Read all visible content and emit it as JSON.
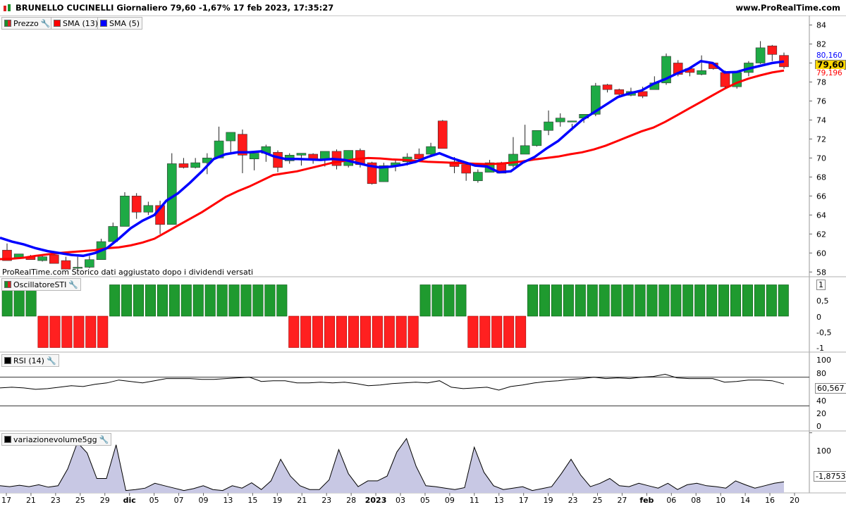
{
  "header": {
    "title": "BRUNELLO CUCINELLI Giornaliero 79,60 -1,67% 17 feb 2023, 17:35:27",
    "site": "www.ProRealTime.com"
  },
  "legend": [
    {
      "label": "Prezzo",
      "color": "#1a8f2a"
    },
    {
      "label": "SMA (13)",
      "color": "#ff0000"
    },
    {
      "label": "SMA (5)",
      "color": "#0000ff"
    }
  ],
  "note": "ProRealTime.com  Storico dati aggiustato dopo i dividendi versati",
  "price_axis": {
    "ticks": [
      "84",
      "82",
      "80",
      "78",
      "76",
      "74",
      "72",
      "70",
      "68",
      "66",
      "64",
      "62",
      "60",
      "58"
    ],
    "badge_sma5": "80,160",
    "badge_price": "79,60",
    "badge_sma13": "79,196"
  },
  "osc_panel": {
    "label": "OscillatoreSTI",
    "ticks": [
      "1",
      "0,5",
      "0",
      "-0,5",
      "-1"
    ]
  },
  "rsi_panel": {
    "label": "RSI (14)",
    "ticks": [
      "100",
      "80",
      "60",
      "40",
      "20",
      "0"
    ],
    "badge": "60,567"
  },
  "vol_panel": {
    "label": "variazionevolume5gg",
    "ticks": [
      "100"
    ],
    "badge": "-1,8753"
  },
  "x_axis": {
    "labels": [
      "17",
      "21",
      "23",
      "25",
      "29",
      "dic",
      "05",
      "07",
      "09",
      "13",
      "15",
      "19",
      "21",
      "23",
      "28",
      "2023",
      "03",
      "05",
      "09",
      "11",
      "13",
      "17",
      "19",
      "23",
      "25",
      "27",
      "feb",
      "06",
      "08",
      "10",
      "14",
      "16",
      "20"
    ]
  },
  "colors": {
    "up": "#1eaa45",
    "down": "#ff1a1a",
    "sma13": "#ff0000",
    "sma5": "#0000ff",
    "osc_up": "#1f9a2f",
    "osc_down": "#ff2020",
    "volume_fill": "#c8c8e4"
  },
  "chart_data": [
    {
      "type": "candlestick",
      "title": "BRUNELLO CUCINELLI Giornaliero",
      "ylim": [
        57.5,
        85
      ],
      "ohlc": [
        [
          60.3,
          61.0,
          59.9,
          59.2
        ],
        [
          59.5,
          59.9,
          59.5,
          59.9
        ],
        [
          59.6,
          59.8,
          59.4,
          59.3
        ],
        [
          59.2,
          59.7,
          59.1,
          59.6
        ],
        [
          59.8,
          60.1,
          59.1,
          58.9
        ],
        [
          59.2,
          59.6,
          58.5,
          58.3
        ],
        [
          58.5,
          59.6,
          58.1,
          58.5
        ],
        [
          58.5,
          59.7,
          58.4,
          59.3
        ],
        [
          59.3,
          61.5,
          59.3,
          61.2
        ],
        [
          61.2,
          63.2,
          61.0,
          62.8
        ],
        [
          62.8,
          66.4,
          62.8,
          66.0
        ],
        [
          66.0,
          66.3,
          63.6,
          64.3
        ],
        [
          64.3,
          65.4,
          64.0,
          65.0
        ],
        [
          65.0,
          65.5,
          62.0,
          63.0
        ],
        [
          63.0,
          70.5,
          63.0,
          69.4
        ],
        [
          69.4,
          70.0,
          68.9,
          69.0
        ],
        [
          69.0,
          70.0,
          68.9,
          69.5
        ],
        [
          69.5,
          70.5,
          68.3,
          70.0
        ],
        [
          70.0,
          73.3,
          70.0,
          71.8
        ],
        [
          71.8,
          72.6,
          70.4,
          72.7
        ],
        [
          72.5,
          73.0,
          68.4,
          70.3
        ],
        [
          69.9,
          70.1,
          68.7,
          70.5
        ],
        [
          70.5,
          71.4,
          69.6,
          71.2
        ],
        [
          70.6,
          70.8,
          68.5,
          69.0
        ],
        [
          69.7,
          70.5,
          69.4,
          70.3
        ],
        [
          70.3,
          70.4,
          69.2,
          70.5
        ],
        [
          70.4,
          70.5,
          69.4,
          69.9
        ],
        [
          69.9,
          70.6,
          69.1,
          70.7
        ],
        [
          70.7,
          70.9,
          68.8,
          69.2
        ],
        [
          69.2,
          70.8,
          69.0,
          70.8
        ],
        [
          70.8,
          71.0,
          69.0,
          69.3
        ],
        [
          69.5,
          69.6,
          67.2,
          67.3
        ],
        [
          67.5,
          69.5,
          67.5,
          69.2
        ],
        [
          69.2,
          69.9,
          68.6,
          69.5
        ],
        [
          69.6,
          70.5,
          69.2,
          70.1
        ],
        [
          70.4,
          71.0,
          69.6,
          69.9
        ],
        [
          70.4,
          71.6,
          70.1,
          71.2
        ],
        [
          73.9,
          74.0,
          71.5,
          71.0
        ],
        [
          69.6,
          70.1,
          68.4,
          69.1
        ],
        [
          69.3,
          69.5,
          67.6,
          68.4
        ],
        [
          67.6,
          68.8,
          67.4,
          68.5
        ],
        [
          68.5,
          69.8,
          68.7,
          69.5
        ],
        [
          69.5,
          69.6,
          68.7,
          68.4
        ],
        [
          69.2,
          72.2,
          69.0,
          70.4
        ],
        [
          70.4,
          73.5,
          70.6,
          71.3
        ],
        [
          71.3,
          72.8,
          71.2,
          72.9
        ],
        [
          72.9,
          75.0,
          72.4,
          73.8
        ],
        [
          73.8,
          74.7,
          73.3,
          74.2
        ],
        [
          73.9,
          73.6,
          72.9,
          73.9
        ],
        [
          74.2,
          74.5,
          73.7,
          74.6
        ],
        [
          74.6,
          77.9,
          74.4,
          77.6
        ],
        [
          77.7,
          77.8,
          76.9,
          77.2
        ],
        [
          77.2,
          77.3,
          76.4,
          76.7
        ],
        [
          76.6,
          77.4,
          76.5,
          77.0
        ],
        [
          77.0,
          77.5,
          76.3,
          76.5
        ],
        [
          77.2,
          78.6,
          77.2,
          77.9
        ],
        [
          77.9,
          81.0,
          77.7,
          80.7
        ],
        [
          80.0,
          80.3,
          78.6,
          78.8
        ],
        [
          79.4,
          79.1,
          78.6,
          79.0
        ],
        [
          78.8,
          80.8,
          78.7,
          79.2
        ],
        [
          80.0,
          80.1,
          79.3,
          79.4
        ],
        [
          79.0,
          79.2,
          77.3,
          77.5
        ],
        [
          77.5,
          79.1,
          77.3,
          79.0
        ],
        [
          79.0,
          80.2,
          78.6,
          80.0
        ],
        [
          80.0,
          82.3,
          79.9,
          81.6
        ],
        [
          81.8,
          81.9,
          80.2,
          80.9
        ],
        [
          80.8,
          81.1,
          79.4,
          79.6
        ]
      ],
      "series": [
        {
          "name": "SMA (13)",
          "values": [
            59.35,
            59.4,
            59.5,
            59.7,
            59.85,
            60.0,
            60.1,
            60.2,
            60.3,
            60.5,
            60.6,
            60.8,
            61.1,
            61.5,
            62.2,
            62.9,
            63.6,
            64.3,
            65.1,
            65.9,
            66.5,
            67.0,
            67.6,
            68.2,
            68.4,
            68.6,
            68.9,
            69.2,
            69.5,
            69.7,
            69.9,
            70.0,
            69.95,
            69.85,
            69.8,
            69.7,
            69.6,
            69.55,
            69.5,
            69.45,
            69.4,
            69.35,
            69.4,
            69.5,
            69.65,
            69.85,
            70.0,
            70.15,
            70.4,
            70.6,
            70.9,
            71.3,
            71.8,
            72.3,
            72.8,
            73.2,
            73.8,
            74.5,
            75.2,
            75.9,
            76.6,
            77.3,
            77.9,
            78.35,
            78.7,
            79.0,
            79.2
          ]
        },
        {
          "name": "SMA (5)",
          "values": [
            61.6,
            61.2,
            60.9,
            60.5,
            60.2,
            60.0,
            59.8,
            59.7,
            60.0,
            60.5,
            61.5,
            62.6,
            63.4,
            64.0,
            65.5,
            66.3,
            67.4,
            68.6,
            69.9,
            70.4,
            70.6,
            70.6,
            70.7,
            70.2,
            69.9,
            69.9,
            69.85,
            69.8,
            69.9,
            69.8,
            69.5,
            69.2,
            69.0,
            69.1,
            69.3,
            69.6,
            70.1,
            70.5,
            70.0,
            69.6,
            69.2,
            69.1,
            68.5,
            68.6,
            69.5,
            70.1,
            71.0,
            71.8,
            72.9,
            74.0,
            74.8,
            75.6,
            76.4,
            76.8,
            77.1,
            77.8,
            78.3,
            78.9,
            79.4,
            80.2,
            80.0,
            79.0,
            79.05,
            79.4,
            79.7,
            80.0,
            80.16
          ]
        }
      ]
    },
    {
      "type": "bar",
      "title": "OscillatoreSTI",
      "ylim": [
        -1.1,
        1.1
      ],
      "values": [
        1,
        1,
        1,
        -1,
        -1,
        -1,
        -1,
        -1,
        -1,
        1,
        1,
        1,
        1,
        1,
        1,
        1,
        1,
        1,
        1,
        1,
        1,
        1,
        1,
        1,
        -1,
        -1,
        -1,
        -1,
        -1,
        -1,
        -1,
        -1,
        -1,
        -1,
        -1,
        1,
        1,
        1,
        1,
        -1,
        -1,
        -1,
        -1,
        -1,
        1,
        1,
        1,
        1,
        1,
        1,
        1,
        1,
        1,
        1,
        1,
        1,
        1,
        1,
        1,
        1,
        1,
        1,
        1,
        1,
        1,
        1
      ]
    },
    {
      "type": "line",
      "title": "RSI (14)",
      "ylim": [
        0,
        100
      ],
      "values": [
        55,
        56,
        55,
        53,
        54,
        56,
        58,
        57,
        60,
        62,
        66,
        64,
        62,
        65,
        68,
        68,
        68,
        67,
        67,
        68,
        69,
        70,
        64,
        65,
        65,
        62,
        62,
        63,
        62,
        63,
        61,
        58,
        59,
        61,
        62,
        63,
        62,
        65,
        56,
        54,
        55,
        56,
        52,
        57,
        59,
        62,
        64,
        65,
        67,
        68,
        70,
        68,
        69,
        68,
        70,
        71,
        74,
        69,
        68,
        68,
        68,
        63,
        64,
        66,
        66,
        65,
        60.567
      ]
    },
    {
      "type": "area",
      "title": "variazionevolume5gg",
      "values": [
        -10,
        -12,
        -9,
        -12,
        -8,
        -13,
        -10,
        25,
        80,
        58,
        5,
        5,
        75,
        -20,
        -18,
        -15,
        -5,
        -10,
        -15,
        -20,
        -16,
        -10,
        -18,
        -20,
        -10,
        -15,
        -4,
        -18,
        0,
        45,
        10,
        -10,
        -18,
        -18,
        2,
        65,
        15,
        -12,
        0,
        0,
        10,
        60,
        88,
        30,
        -10,
        -12,
        -15,
        -18,
        -14,
        70,
        18,
        -10,
        -18,
        -15,
        -12,
        -20,
        -16,
        -12,
        15,
        45,
        12,
        -12,
        -5,
        5,
        -10,
        -12,
        -5,
        -10,
        -15,
        -5,
        -18,
        -8,
        -5,
        -10,
        -12,
        -15,
        0,
        -8,
        -15,
        -10,
        -5,
        -1.8753
      ]
    }
  ]
}
